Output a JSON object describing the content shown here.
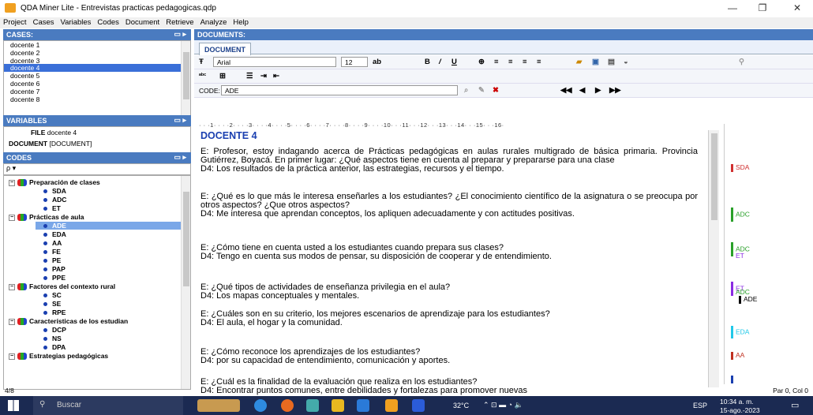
{
  "window": {
    "title": "QDA Miner Lite - Entrevistas practicas pedagogicas.qdp"
  },
  "menu": [
    "Project",
    "Cases",
    "Variables",
    "Codes",
    "Document",
    "Retrieve",
    "Analyze",
    "Help"
  ],
  "cases": {
    "header": "CASES:",
    "items": [
      "docente 1",
      "docente 2",
      "docente 3",
      "docente 4",
      "docente 5",
      "docente 6",
      "docente 7",
      "docente 8"
    ],
    "selected": "docente 4"
  },
  "variables": {
    "header": "VARIABLES",
    "rows": [
      {
        "name": "FILE",
        "value": "docente 4"
      },
      {
        "name": "DOCUMENT",
        "value": "[DOCUMENT]"
      }
    ]
  },
  "codes": {
    "header": "CODES",
    "search_placeholder": "ρ ▾",
    "categories": [
      {
        "name": "Preparación de clases",
        "codes": [
          "SDA",
          "ADC",
          "ET"
        ]
      },
      {
        "name": "Prácticas de aula",
        "codes": [
          "ADE",
          "EDA",
          "AA",
          "FE",
          "PE",
          "PAP",
          "PPE"
        ]
      },
      {
        "name": "Factores del contexto rural",
        "codes": [
          "SC",
          "SE",
          "RPE"
        ]
      },
      {
        "name": "Características de los estudian",
        "codes": [
          "DCP",
          "NS",
          "DPA"
        ]
      },
      {
        "name": "Estrategias pedagógicas",
        "codes": []
      }
    ],
    "selected": "ADE"
  },
  "documents": {
    "header": "DOCUMENTS:",
    "tab": "DOCUMENT",
    "font": "Arial",
    "size": "12",
    "code_label": "CODE:",
    "code_value": "ADE"
  },
  "document": {
    "title": "DOCENTE 4",
    "paragraphs": [
      "E: Profesor, estoy indagando acerca de Prácticas pedagógicas en aulas rurales multigrado de básica primaria. Provincia Gutiérrez, Boyacá. En primer lugar: ¿Qué aspectos tiene en cuenta al preparar y prepararse para una clase\nD4: Los resultados de la práctica anterior, las estrategias, recursos y el tiempo.",
      "E: ¿Qué es lo que más le interesa enseñarles a los estudiantes? ¿El conocimiento científico de la asignatura o se preocupa por otros aspectos? ¿Que otros aspectos?\nD4: Me interesa que aprendan conceptos, los apliquen adecuadamente y con actitudes positivas.",
      "E: ¿Cómo tiene en cuenta usted a los estudiantes cuando prepara sus clases?\nD4: Tengo en cuenta sus modos de pensar, su disposición de cooperar y de entendimiento.",
      "E: ¿Qué tipos de actividades de enseñanza privilegia en el aula?\nD4: Los mapas conceptuales y mentales.",
      "E: ¿Cuáles son en su criterio, los mejores escenarios de aprendizaje para los estudiantes?\nD4: El aula, el hogar y la comunidad.",
      "E: ¿Cómo reconoce los aprendizajes de los estudiantes?\nD4: por su capacidad de entendimiento, comunicación y aportes.",
      "E: ¿Cuál es la finalidad de la evaluación que realiza en los estudiantes?\nD4: Encontrar puntos comunes, entre debilidades y fortalezas para promover nuevas"
    ]
  },
  "margin_codes": [
    {
      "label": "SDA",
      "color": "#d03030"
    },
    {
      "label": "ADC",
      "color": "#2aa02a"
    },
    {
      "label": "ADC",
      "color": "#2aa02a"
    },
    {
      "label": "ET",
      "color": "#8a2be2"
    },
    {
      "label": "ET",
      "color": "#8a2be2"
    },
    {
      "label": "ADC",
      "color": "#2aa02a"
    },
    {
      "label": "ADE",
      "color": "#000000"
    },
    {
      "label": "EDA",
      "color": "#20c8e8"
    },
    {
      "label": "AA",
      "color": "#c03020"
    }
  ],
  "status": {
    "left": "4/8",
    "right": "Par 0, Col 0"
  },
  "taskbar": {
    "search": "Buscar",
    "temp": "32°C",
    "lang": "ESP",
    "time": "10:34 a. m.",
    "date": "15-ago.-2023"
  }
}
